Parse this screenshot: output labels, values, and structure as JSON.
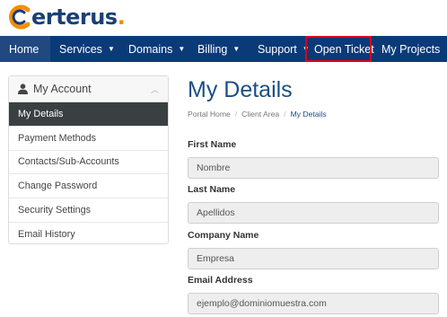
{
  "brand": {
    "name": "erterus",
    "dot": "."
  },
  "nav": {
    "items": [
      {
        "label": "Home"
      },
      {
        "label": "Services"
      },
      {
        "label": "Domains"
      },
      {
        "label": "Billing"
      },
      {
        "label": "Support"
      },
      {
        "label": "Open Ticket"
      },
      {
        "label": "My Projects"
      }
    ]
  },
  "sidebar": {
    "title": "My Account",
    "items": [
      {
        "label": "My Details"
      },
      {
        "label": "Payment Methods"
      },
      {
        "label": "Contacts/Sub-Accounts"
      },
      {
        "label": "Change Password"
      },
      {
        "label": "Security Settings"
      },
      {
        "label": "Email History"
      }
    ]
  },
  "main": {
    "title": "My Details",
    "breadcrumb": [
      "Portal Home",
      "Client Area",
      "My Details"
    ],
    "fields": [
      {
        "label": "First Name",
        "value": "Nombre"
      },
      {
        "label": "Last Name",
        "value": "Apellidos"
      },
      {
        "label": "Company Name",
        "value": "Empresa"
      },
      {
        "label": "Email Address",
        "value": "ejemplo@dominiomuestra.com"
      }
    ]
  },
  "colors": {
    "nav_bg": "#0b3a78",
    "brand_blue": "#1b3f74",
    "brand_orange": "#f29000",
    "highlight_outline": "#e0001b"
  }
}
